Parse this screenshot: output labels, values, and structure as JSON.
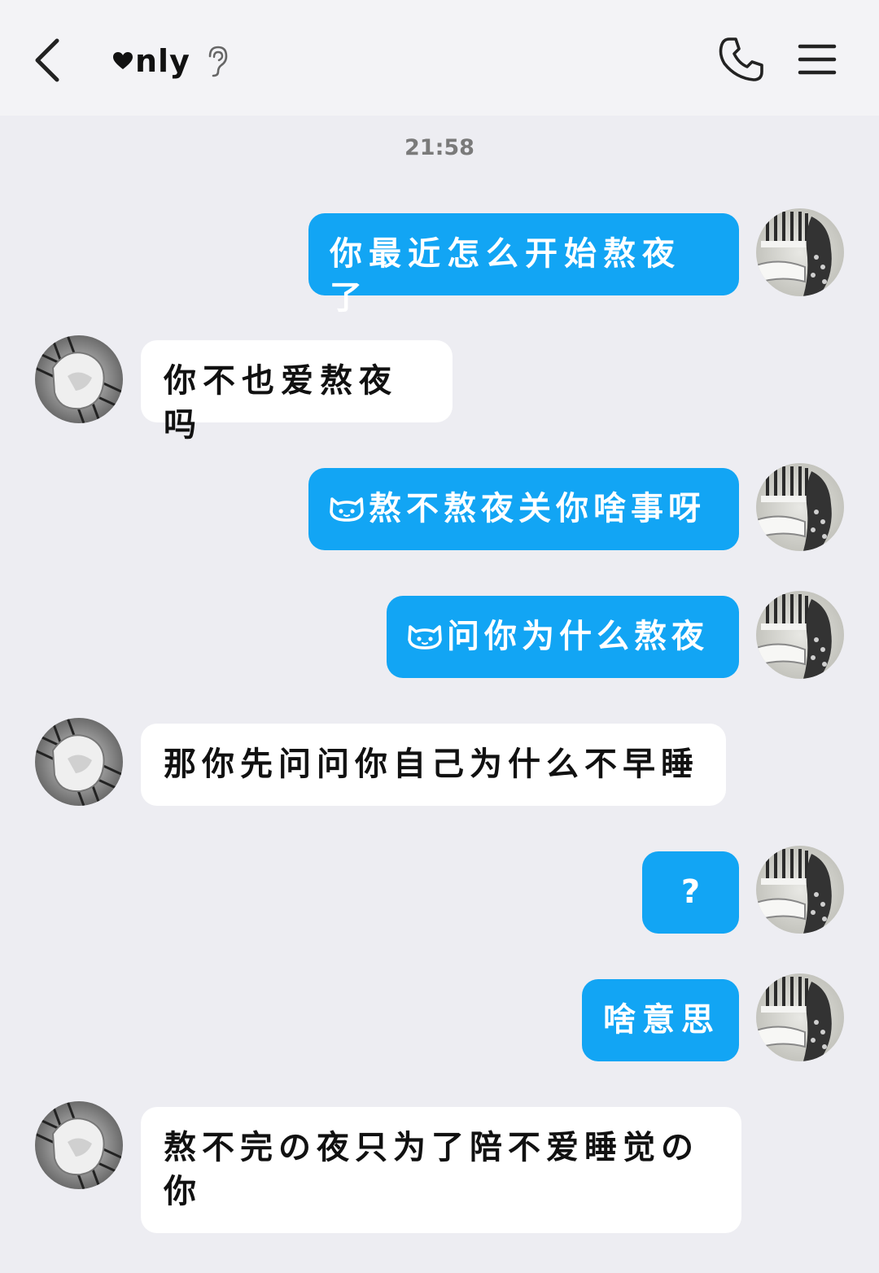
{
  "header": {
    "title": "nly",
    "back_icon": "chevron-left-icon",
    "ear_icon": "ear-icon",
    "phone_icon": "phone-icon",
    "menu_icon": "menu-icon"
  },
  "timestamp": "21:58",
  "colors": {
    "outgoing_bubble": "#12a5f4",
    "incoming_bubble": "#ffffff",
    "background": "#ededf2"
  },
  "messages": [
    {
      "side": "out",
      "text": "你最近怎么开始熬夜了"
    },
    {
      "side": "in",
      "text": "你不也爱熬夜吗"
    },
    {
      "side": "out",
      "emoji": "cat-face-icon",
      "text": "熬不熬夜关你啥事呀"
    },
    {
      "side": "out",
      "emoji": "cat-face-icon",
      "text": "问你为什么熬夜"
    },
    {
      "side": "in",
      "text": "那你先问问你自己为什么不早睡"
    },
    {
      "side": "out",
      "text": "?"
    },
    {
      "side": "out",
      "text": "啥意思"
    },
    {
      "side": "in",
      "text": "熬不完の夜只为了陪不爱睡觉の你"
    }
  ]
}
